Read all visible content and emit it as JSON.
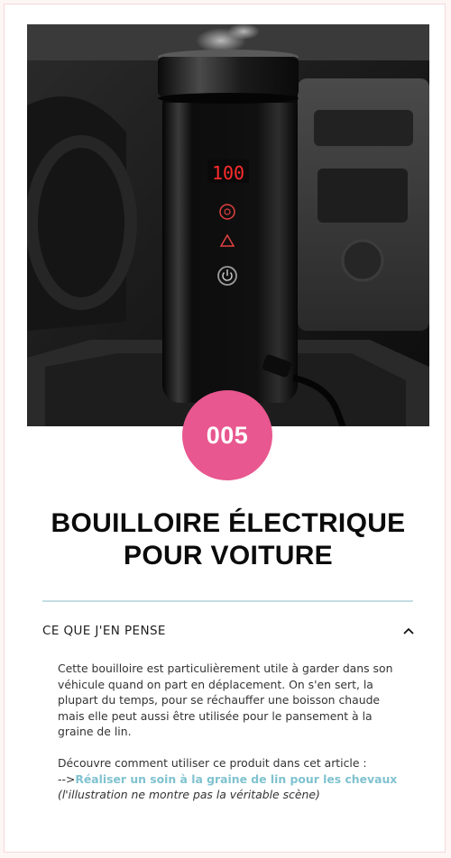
{
  "product": {
    "number": "005",
    "title_line1": "BOUILLOIRE ÉLECTRIQUE",
    "title_line2": "POUR VOITURE",
    "display_reading": "100"
  },
  "accordion": {
    "header": "CE QUE J'EN PENSE",
    "expanded": true,
    "paragraph": "Cette bouilloire est particulièrement utile à garder dans son véhicule quand on part en déplacement. On s'en sert, la plupart du temps, pour se réchauffer une boisson chaude mais elle peut aussi être utilisée pour le pansement à la graine de lin.",
    "article_intro": "Découvre comment utiliser ce produit dans cet article :",
    "link_prefix": "-->",
    "link_text": "Réaliser un soin à la graine de lin pour les chevaux",
    "note": "(l'illustration ne montre pas la véritable scène)"
  },
  "colors": {
    "badge": "#e8578f",
    "link": "#7fc2cf",
    "divider": "#c5dde3",
    "title": "#0b0b0b"
  },
  "icons": {
    "accordion_toggle": "chevron-up-icon"
  }
}
